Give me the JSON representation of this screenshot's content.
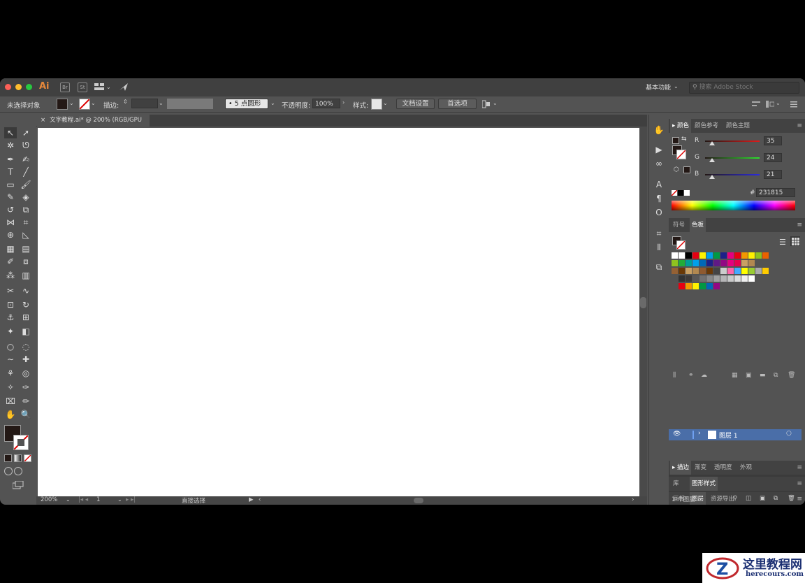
{
  "app": {
    "icon_label": "Ai",
    "icon_br": "Br",
    "icon_st": "St",
    "workspace": "基本功能",
    "search_placeholder": "搜索 Adobe Stock"
  },
  "control_bar": {
    "selection": "未选择对象",
    "stroke_label": "描边:",
    "brush": "5 点圆形",
    "opacity_label": "不透明度:",
    "opacity_value": "100%",
    "style_label": "样式:",
    "doc_setup": "文档设置",
    "preferences": "首选项"
  },
  "document_tab": {
    "close": "×",
    "title": "文字教程.ai* @ 200% (RGB/GPU 预览)"
  },
  "status_bar": {
    "zoom": "200%",
    "artboard": "1",
    "tool": "直接选择"
  },
  "color_panel": {
    "tabs": [
      "颜色",
      "颜色参考",
      "颜色主题"
    ],
    "channels": [
      {
        "label": "R",
        "value": "35",
        "color": "#d23c3c"
      },
      {
        "label": "G",
        "value": "24",
        "color": "#39b54a"
      },
      {
        "label": "B",
        "value": "21",
        "color": "#3b3bd6"
      }
    ],
    "hex_label": "#",
    "hex_value": "231815"
  },
  "swatches_panel": {
    "tabs": [
      "符号",
      "色板"
    ]
  },
  "stroke_panel": {
    "tabs": [
      "描边",
      "渐变",
      "透明度",
      "外观"
    ]
  },
  "library_panel": {
    "tabs": [
      "库",
      "图形样式"
    ]
  },
  "layers_panel": {
    "tabs": [
      "画板",
      "图层",
      "资源导出"
    ],
    "layers": [
      {
        "name": "图层 1"
      }
    ],
    "count": "1 个图层"
  },
  "watermark": {
    "title": "这里教程网",
    "url": "herecours.com"
  },
  "colors": {
    "fill": "#231815",
    "ui_bg": "#535353",
    "dark": "#404040",
    "layer_highlight": "#4a6ea8"
  }
}
